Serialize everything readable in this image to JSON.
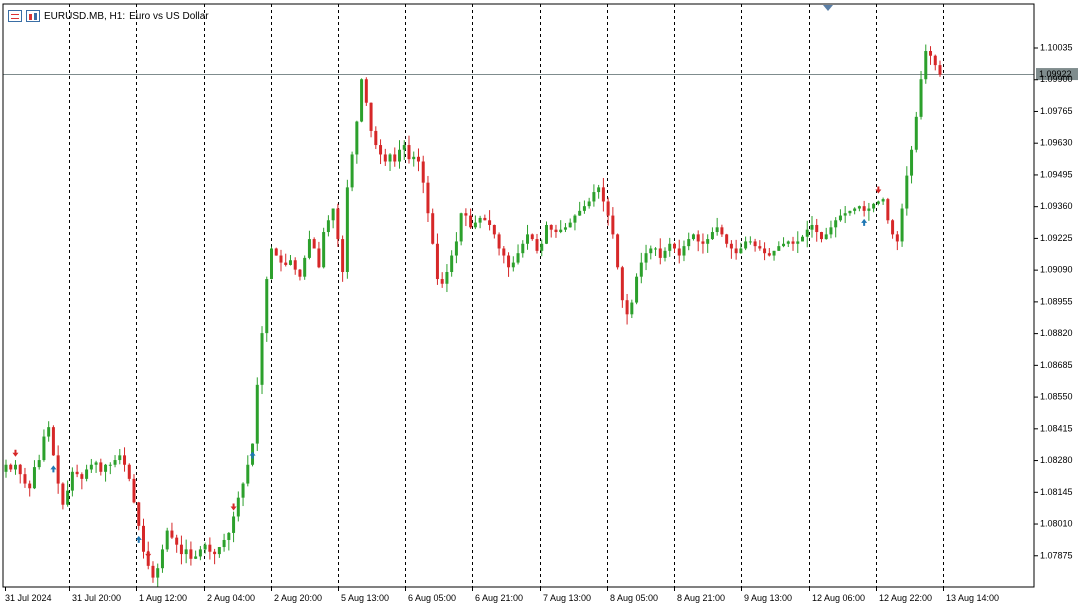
{
  "header": {
    "symbol_info": "EURUSD.MB, H1:",
    "description": "Euro vs US Dollar"
  },
  "current_price": "1.09922",
  "colors": {
    "bull": "#2ca02c",
    "bear": "#d62728",
    "grid": "#000000",
    "price_line": "#7f8c8d",
    "badge_bg": "#7f8c8d",
    "marker_buy": "#1f77b4",
    "marker_sell": "#d62728"
  },
  "chart_data": {
    "type": "candlestick",
    "price_axis_ticks": [
      "1.10035",
      "1.09900",
      "1.09765",
      "1.09630",
      "1.09495",
      "1.09360",
      "1.09225",
      "1.09090",
      "1.08955",
      "1.08820",
      "1.08685",
      "1.08550",
      "1.08415",
      "1.08280",
      "1.08145",
      "1.08010",
      "1.07875"
    ],
    "time_axis_labels": [
      "31 Jul 2024",
      "31 Jul 20:00",
      "1 Aug 12:00",
      "2 Aug 04:00",
      "2 Aug 20:00",
      "5 Aug 13:00",
      "6 Aug 05:00",
      "6 Aug 21:00",
      "7 Aug 13:00",
      "8 Aug 05:00",
      "8 Aug 21:00",
      "9 Aug 13:00",
      "12 Aug 06:00",
      "12 Aug 22:00",
      "13 Aug 14:00"
    ],
    "ylim": [
      1.0774,
      1.1022
    ],
    "close_path": [
      1.0826,
      1.0824,
      1.0826,
      1.0822,
      1.0818,
      1.0816,
      1.0825,
      1.0828,
      1.0838,
      1.0842,
      1.083,
      1.0818,
      1.0809,
      1.0815,
      1.0823,
      1.0822,
      1.082,
      1.0824,
      1.0826,
      1.0827,
      1.0823,
      1.0826,
      1.0826,
      1.0828,
      1.083,
      1.0826,
      1.082,
      1.081,
      1.08,
      1.0789,
      1.0783,
      1.0778,
      1.0782,
      1.079,
      1.0798,
      1.0795,
      1.0792,
      1.0788,
      1.079,
      1.0786,
      1.0787,
      1.079,
      1.0792,
      1.0789,
      1.0788,
      1.0791,
      1.0794,
      1.0797,
      1.0804,
      1.0812,
      1.0818,
      1.0826,
      1.0835,
      1.086,
      1.0882,
      1.0905,
      1.0918,
      1.0915,
      1.0912,
      1.0911,
      1.0913,
      1.0909,
      1.0906,
      1.0914,
      1.0922,
      1.0918,
      1.091,
      1.0925,
      1.093,
      1.0935,
      1.0922,
      1.0908,
      1.0944,
      1.0958,
      1.0972,
      1.099,
      1.098,
      1.0968,
      1.0962,
      1.0958,
      1.0955,
      1.0958,
      1.0955,
      1.096,
      1.0962,
      1.0956,
      1.0957,
      1.0955,
      1.0946,
      1.0933,
      1.092,
      1.0905,
      1.0903,
      1.0908,
      1.0915,
      1.0921,
      1.0933,
      1.0932,
      1.0927,
      1.0929,
      1.0931,
      1.093,
      1.0928,
      1.0924,
      1.0918,
      1.0915,
      1.091,
      1.0912,
      1.0916,
      1.092,
      1.0924,
      1.0922,
      1.0917,
      1.092,
      1.0928,
      1.0926,
      1.0925,
      1.0926,
      1.0927,
      1.0929,
      1.0932,
      1.0934,
      1.0936,
      1.0938,
      1.0942,
      1.0944,
      1.0938,
      1.0932,
      1.0924,
      1.091,
      1.0896,
      1.089,
      1.0895,
      1.0906,
      1.0912,
      1.0916,
      1.0918,
      1.0918,
      1.0914,
      1.0917,
      1.092,
      1.0918,
      1.0915,
      1.0919,
      1.0922,
      1.0924,
      1.0921,
      1.092,
      1.0922,
      1.0925,
      1.0927,
      1.0924,
      1.092,
      1.0918,
      1.0916,
      1.0918,
      1.0921,
      1.0921,
      1.0919,
      1.0918,
      1.0916,
      1.0915,
      1.0917,
      1.0919,
      1.092,
      1.0921,
      1.092,
      1.0921,
      1.0923,
      1.0926,
      1.0928,
      1.0925,
      1.0922,
      1.0924,
      1.0927,
      1.093,
      1.0932,
      1.0933,
      1.0934,
      1.0935,
      1.0936,
      1.0934,
      1.0935,
      1.0937,
      1.0938,
      1.0939,
      1.093,
      1.0924,
      1.0921,
      1.0935,
      1.0949,
      1.096,
      1.0974,
      1.099,
      1.1002,
      1.1,
      1.0996,
      1.0992
    ]
  }
}
